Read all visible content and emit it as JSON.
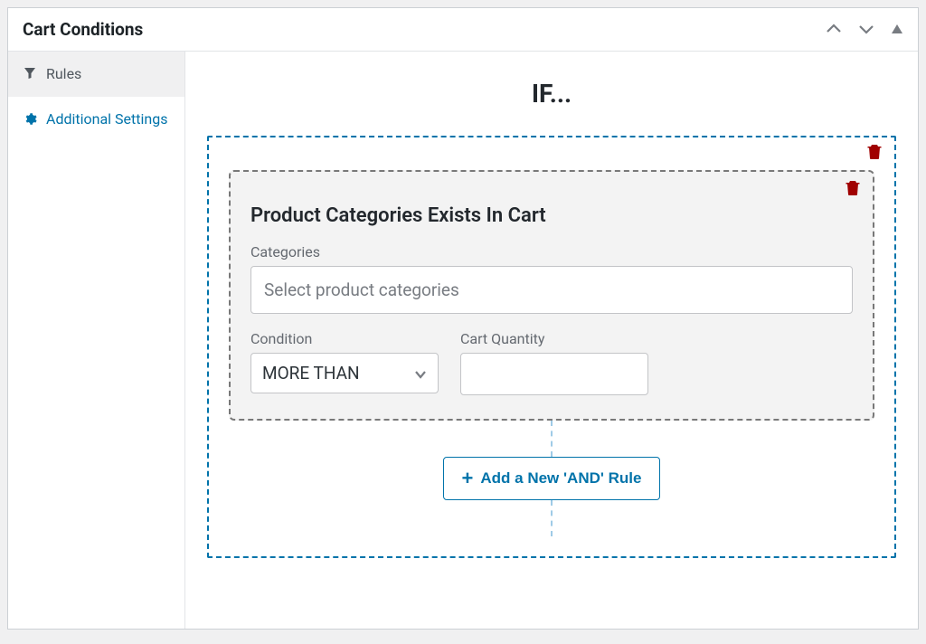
{
  "panel": {
    "title": "Cart Conditions"
  },
  "sidebar": {
    "items": [
      {
        "label": "Rules"
      },
      {
        "label": "Additional Settings"
      }
    ]
  },
  "main": {
    "heading": "IF...",
    "rule": {
      "title": "Product Categories Exists In Cart",
      "categories_label": "Categories",
      "categories_placeholder": "Select product categories",
      "condition_label": "Condition",
      "condition_value": "MORE THAN",
      "quantity_label": "Cart Quantity",
      "quantity_value": ""
    },
    "add_button": "Add a New 'AND' Rule"
  }
}
